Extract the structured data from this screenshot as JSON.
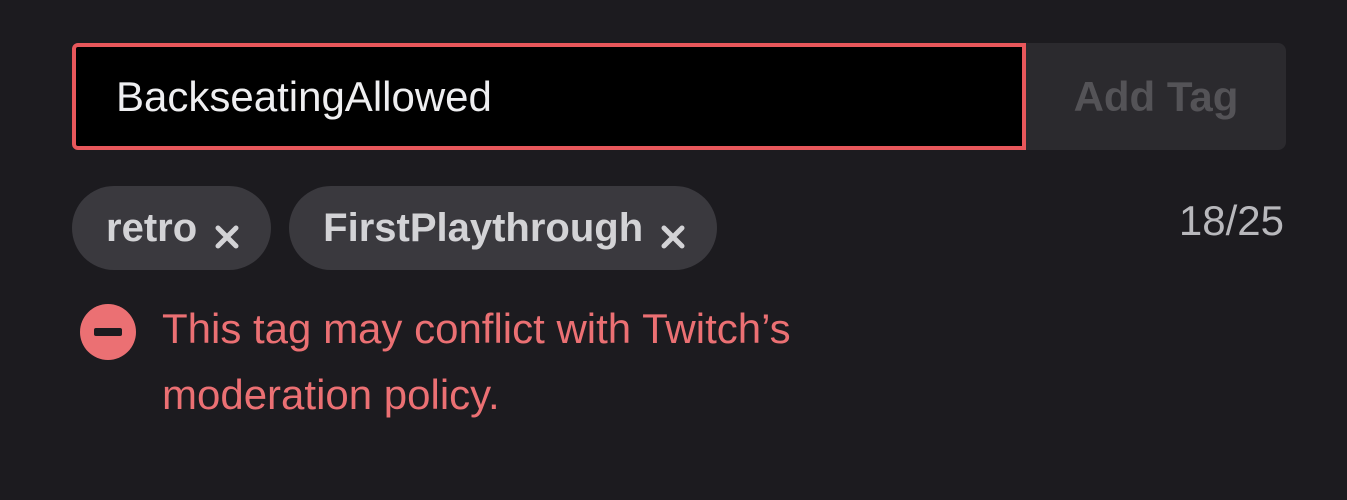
{
  "tag_input": {
    "value": "BackseatingAllowed"
  },
  "add_button": {
    "label": "Add Tag"
  },
  "tags": [
    {
      "label": "retro"
    },
    {
      "label": "FirstPlaythrough"
    }
  ],
  "counter": "18/25",
  "error": {
    "message": "This tag may conflict with Twitch’s moderation policy.",
    "icon": "minus-circle-icon"
  },
  "colors": {
    "background": "#1c1b1f",
    "error": "#eb7073",
    "input_border_error": "#e8575b",
    "chip_bg": "#3a393e",
    "button_bg": "#2b2a2e"
  }
}
